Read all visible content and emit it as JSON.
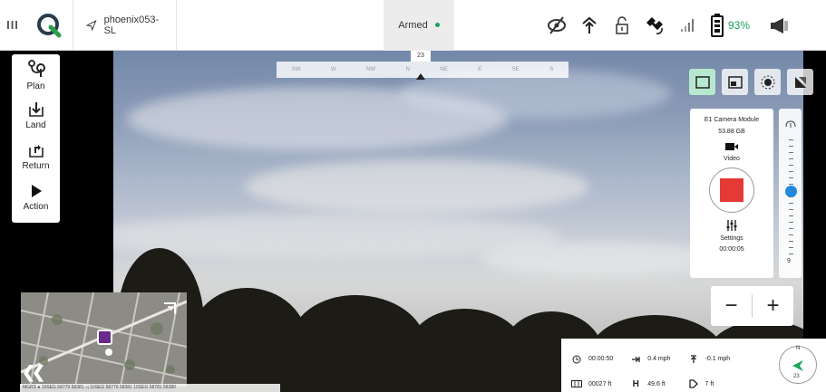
{
  "topbar": {
    "menu_glyph": "III",
    "logo_icon": "qgc-logo-icon",
    "vehicle_name": "phoenix053-SL",
    "armed_status": "Armed",
    "armed_color": "#1aa35a",
    "battery_percent": "93%",
    "battery_color": "#1aa35a",
    "status_icons": [
      "no-video-icon",
      "rc-signal-icon",
      "unlocked-icon",
      "gps-icon",
      "signal-bars-icon",
      "battery-icon",
      "megaphone-icon"
    ]
  },
  "left_panel": {
    "items": [
      {
        "label": "Plan",
        "icon": "plan-route-icon"
      },
      {
        "label": "Land",
        "icon": "land-icon"
      },
      {
        "label": "Return",
        "icon": "return-icon"
      },
      {
        "label": "Action",
        "icon": "play-icon"
      }
    ]
  },
  "compass_bar": {
    "heading": "23",
    "labels": [
      "SW",
      "W",
      "NW",
      "N",
      "NE",
      "E",
      "SE",
      "S"
    ]
  },
  "view_buttons": [
    "camera-view-icon",
    "pip-view-icon",
    "thermal-view-icon",
    "split-view-icon"
  ],
  "camera_panel": {
    "module_name": "E1 Camera Module",
    "storage": "53.88 GB",
    "mode_label": "Video",
    "settings_label": "Settings",
    "elapsed": "00:00:05",
    "record_color": "#e53935"
  },
  "zoom_panel": {
    "top_icon": "zoom-lens-icon",
    "level_label": "9",
    "slider_fraction": 0.45,
    "knob_color": "#1e88e5"
  },
  "zoom_buttons": {
    "minus": "−",
    "plus": "+"
  },
  "map": {
    "coord_line": "MGRS ● 10SEG 58779 58381 ◁ 10SEG 58779 58381     10SEG 58781 58380",
    "collapse_glyph": "❮❮"
  },
  "telemetry": {
    "time": "00:00:50",
    "distance": "00027 ft",
    "horizontal_speed": "0.4 mph",
    "altitude": "49.6 ft",
    "vertical_speed": "-0.1 mph",
    "distance_to_home": "7 ft",
    "compass_north": "N",
    "compass_heading": "23"
  }
}
